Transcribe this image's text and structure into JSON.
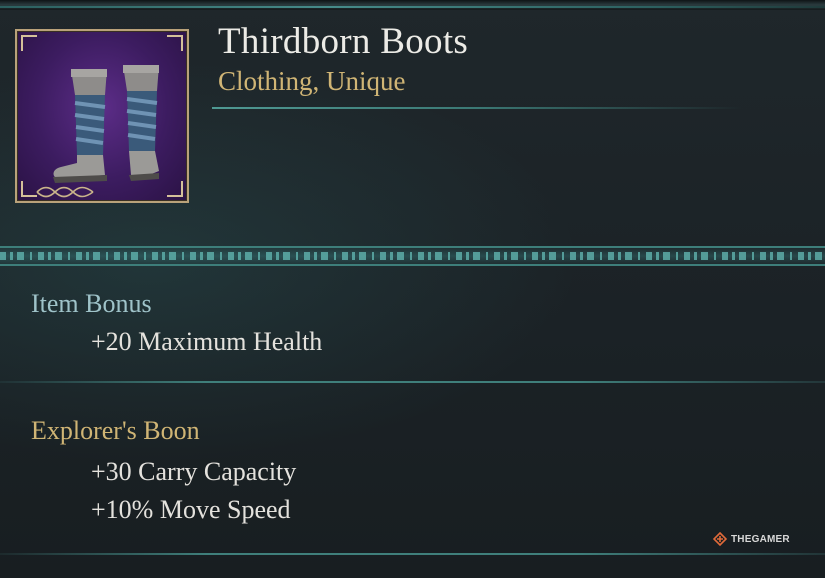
{
  "item": {
    "name": "Thirdborn Boots",
    "type": "Clothing, Unique",
    "icon": "boots-icon"
  },
  "sections": [
    {
      "heading": "Item Bonus",
      "stats": [
        "+20 Maximum Health"
      ]
    },
    {
      "heading": "Explorer's Boon",
      "stats": [
        "+30 Carry Capacity",
        "+10% Move Speed"
      ]
    }
  ],
  "watermark": {
    "text": "THEGAMER",
    "logo": "thegamer-logo-icon"
  },
  "colors": {
    "background": "#1c2226",
    "title": "#ecebe6",
    "subtitle_gold": "#d0b575",
    "heading_teal": "#9fc3c9",
    "accent_teal": "#3d7e7a",
    "icon_frame": "#b9a27a",
    "icon_bg": "#3c1c60"
  }
}
